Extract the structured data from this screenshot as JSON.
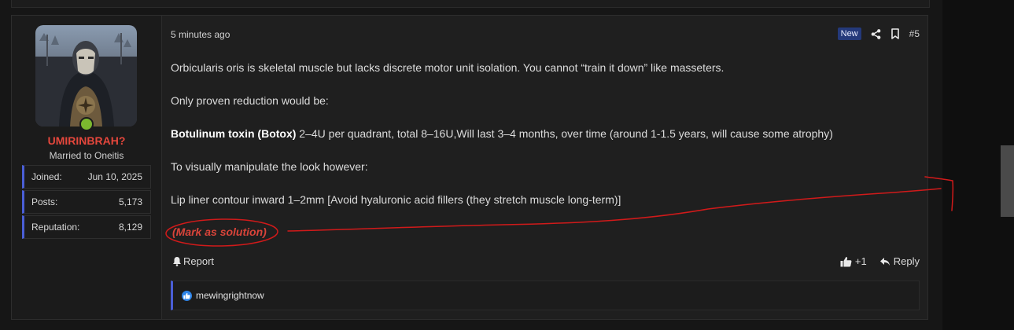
{
  "post": {
    "user": {
      "name": "UMIRINBRAH?",
      "title": "Married to Oneitis",
      "stats": [
        {
          "label": "Joined:",
          "value": "Jun 10, 2025"
        },
        {
          "label": "Posts:",
          "value": "5,173"
        },
        {
          "label": "Reputation:",
          "value": "8,129"
        }
      ]
    },
    "header": {
      "timestamp": "5 minutes ago",
      "badge": "New",
      "post_number": "#5"
    },
    "body": {
      "p1": "Orbicularis oris is skeletal muscle but lacks discrete motor unit isolation. You cannot “train it down” like masseters.",
      "p2": "Only proven reduction would be:",
      "p3_bold": "Botulinum toxin (Botox)",
      "p3_rest": " 2–4U per quadrant, total 8–16U,Will last 3–4 months, over time (around 1-1.5 years, will cause some atrophy)",
      "p4": "To visually manipulate the look however:",
      "p5": "Lip liner contour inward 1–2mm [Avoid hyaluronic acid fillers (they stretch muscle long-term)]"
    },
    "mark_solution": "(Mark as solution)",
    "actions": {
      "report": "Report",
      "like_count": "+1",
      "reply": "Reply"
    },
    "reactions": {
      "users": "mewingrightnow"
    }
  },
  "colors": {
    "accent": "#4a5ed6",
    "username": "#e5473c",
    "annotation": "#d11a1a",
    "new_badge": "#24397a",
    "online": "#7cb82f"
  },
  "icons": [
    "share-icon",
    "bookmark-icon",
    "bell-icon",
    "thumbs-up-icon",
    "reply-icon",
    "like-reaction-icon"
  ]
}
